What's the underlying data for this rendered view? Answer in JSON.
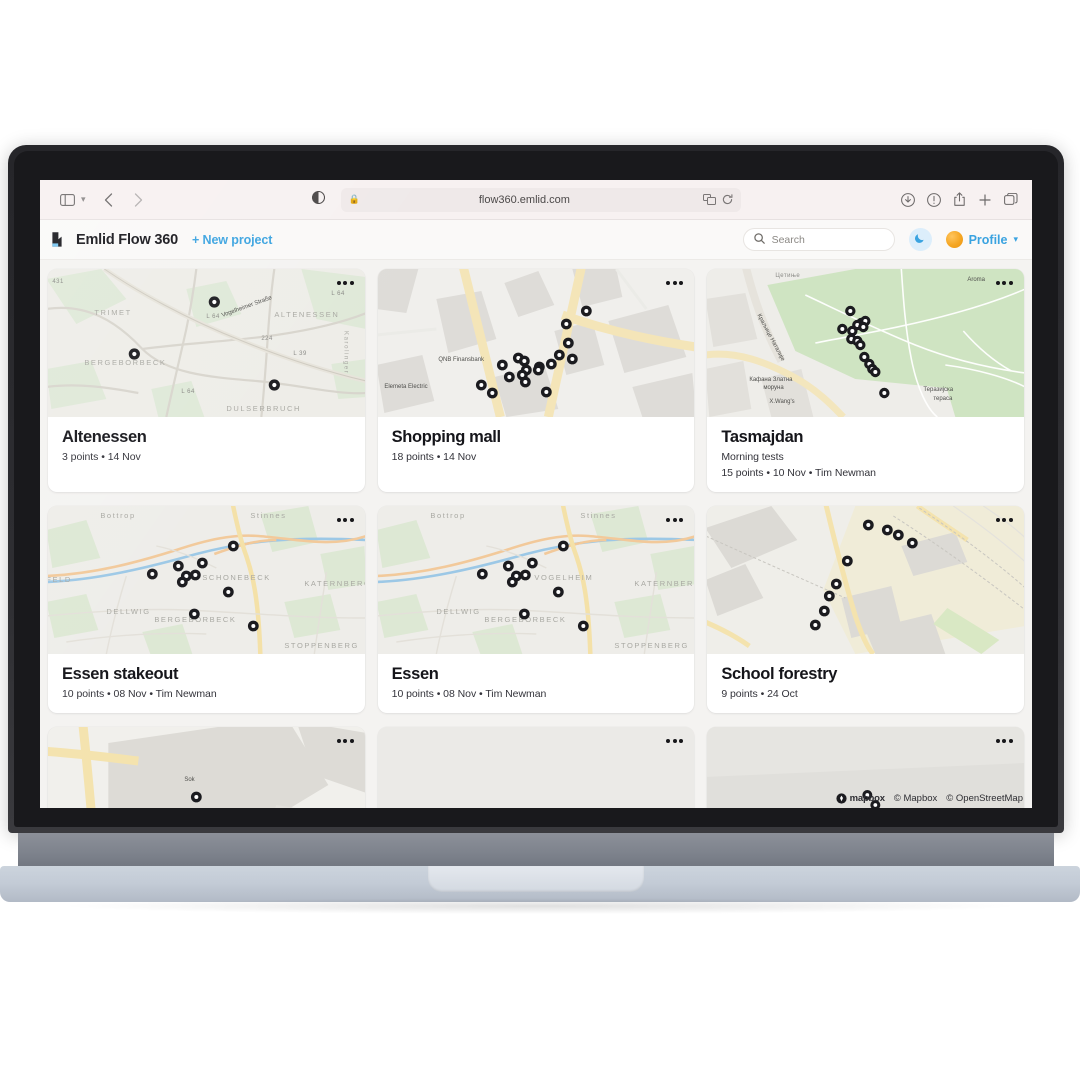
{
  "browser": {
    "url": "flow360.emlid.com",
    "lock_icon": "lock-icon",
    "sidebar_icon": "sidebar-toggle-icon",
    "back_label": "‹",
    "forward_label": "›",
    "reader_icon": "reader-mode-icon",
    "extensions_icon": "extensions-icon",
    "reload_icon": "reload-icon",
    "downloads_icon": "downloads-icon",
    "info_icon": "info-icon",
    "share_icon": "share-icon",
    "newtab_icon": "plus-icon",
    "tabs_icon": "tab-overview-icon"
  },
  "app_header": {
    "brand_name": "Emlid Flow 360",
    "new_project_label": "+ New project",
    "search_placeholder": "Search",
    "theme_toggle_icon": "moon-icon",
    "profile_label": "Profile",
    "profile_caret": "⌄",
    "accent_color": "#3aa3e0",
    "avatar_color": "#f5a623"
  },
  "attribution": {
    "logo_text": "mapbox",
    "mapbox": "© Mapbox",
    "osm": "© OpenStreetMap"
  },
  "projects": [
    {
      "title": "Altenessen",
      "subtitle": "",
      "meta": "3 points • 14 Nov",
      "points": 3,
      "date": "14 Nov",
      "author": "",
      "map_labels": [
        "TRIMET",
        "BERGEBORBECK",
        "ALTENESSEN",
        "DULSERBRUCH",
        "Vogelheimer Straße",
        "L 64",
        "224",
        "L 39",
        "431"
      ]
    },
    {
      "title": "Shopping mall",
      "subtitle": "",
      "meta": "18 points • 14 Nov",
      "points": 18,
      "date": "14 Nov",
      "author": "",
      "map_labels": [
        "QNB Finansbank",
        "Elemeta Electric"
      ]
    },
    {
      "title": "Tasmajdan",
      "subtitle": "Morning tests",
      "meta": "15 points • 10 Nov • Tim Newman",
      "points": 15,
      "date": "10 Nov",
      "author": "Tim Newman",
      "map_labels": [
        "Aroma",
        "Краљице Наталије",
        "Кафана Златна моруна",
        "X.Wang's",
        "Теразијска тераса",
        "Цетиње"
      ]
    },
    {
      "title": "Essen stakeout",
      "subtitle": "",
      "meta": "10 points • 08 Nov • Tim Newman",
      "points": 10,
      "date": "08 Nov",
      "author": "Tim Newman",
      "map_labels": [
        "Bottrop",
        "Stinnes",
        "SCHONEBECK",
        "KATERNBERG",
        "DELLWIG",
        "BERGEBORBECK",
        "STOPPENBERG",
        "FELD"
      ]
    },
    {
      "title": "Essen",
      "subtitle": "",
      "meta": "10 points • 08 Nov • Tim Newman",
      "points": 10,
      "date": "08 Nov",
      "author": "Tim Newman",
      "map_labels": [
        "Bottrop",
        "Stinnes",
        "VOGELHEIM",
        "KATERNBERG",
        "DELLWIG",
        "BERGEBORBECK",
        "STOPPENBERG"
      ]
    },
    {
      "title": "School forestry",
      "subtitle": "",
      "meta": "9 points • 24 Oct",
      "points": 9,
      "date": "24 Oct",
      "author": "",
      "map_labels": []
    }
  ],
  "partial_projects": [
    {
      "points": 2,
      "map_labels": [
        "Sok"
      ]
    },
    {
      "points": 0,
      "map_labels": []
    },
    {
      "points": 2,
      "map_labels": []
    }
  ],
  "card_menu": {
    "icon": "ellipsis-icon",
    "label": "•••"
  }
}
